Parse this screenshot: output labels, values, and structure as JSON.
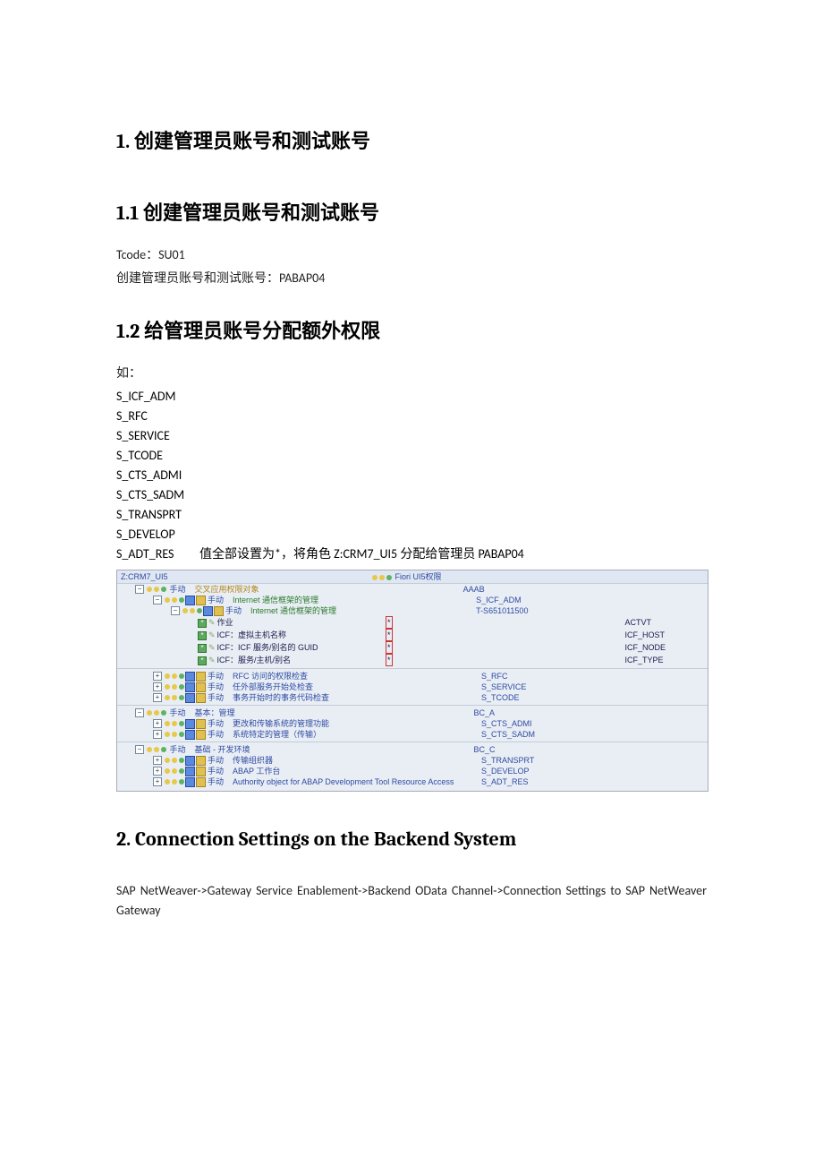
{
  "h1_1": "1. 创建管理员账号和测试账号",
  "h2_11": "1.1  创建管理员账号和测试账号",
  "p_tcode": "Tcode：SU01",
  "p_create": "创建管理员账号和测试账号：PABAP04",
  "h2_12": "1.2  给管理员账号分配额外权限",
  "p_ru": "如：",
  "perms": [
    "S_ICF_ADM",
    "S_RFC",
    "S_SERVICE",
    "S_TCODE",
    "S_CTS_ADMI",
    "S_CTS_SADM",
    "S_TRANSPRT",
    "S_DEVELOP"
  ],
  "perm_last_key": "S_ADT_RES",
  "perm_last_txt": "值全部设置为*，将角色 Z:CRM7_UI5 分配给管理员 PABAP04",
  "h1_2": "2. Connection Settings on the Backend System",
  "p_conn": "SAP NetWeaver->Gateway Service Enablement->Backend OData Channel->Connection Settings to SAP NetWeaver Gateway",
  "sap": {
    "title_left": "Z:CRM7_UI5",
    "title_mid": "Fiori UI5权限",
    "r1_manual": "手动",
    "r1_txt": "交叉应用权限对象",
    "r1_code": "AAAB",
    "r2_txt": "Internet 通信框架的管理",
    "r2_code": "S_ICF_ADM",
    "r3_txt": "Internet 通信框架的管理",
    "r3_code": "T-S651011500",
    "leaf1": "作业",
    "leaf2": "ICF：虚拟主机名称",
    "leaf3": "ICF：ICF 服务/别名的 GUID",
    "leaf4": "ICF：服务/主机/别名",
    "rt1": "ACTVT",
    "rt2": "ICF_HOST",
    "rt3": "ICF_NODE",
    "rt4": "ICF_TYPE",
    "g2_a": "RFC 访问的权限检查",
    "g2_b": "任外部服务开始处检查",
    "g2_c": "事务开始时的事务代码检查",
    "g2_ca": "S_RFC",
    "g2_cb": "S_SERVICE",
    "g2_cc": "S_TCODE",
    "g3_head": "基本：管理",
    "g3_head_code": "BC_A",
    "g3_a": "更改和传输系统的管理功能",
    "g3_b": "系统特定的管理（传输）",
    "g3_ca": "S_CTS_ADMI",
    "g3_cb": "S_CTS_SADM",
    "g4_head": "基础 -  开发环境",
    "g4_head_code": "BC_C",
    "g4_a": "传输组织器",
    "g4_b": "ABAP 工作台",
    "g4_c": "Authority object for ABAP Development Tool Resource Access",
    "g4_ca": "S_TRANSPRT",
    "g4_cb": "S_DEVELOP",
    "g4_cc": "S_ADT_RES"
  }
}
